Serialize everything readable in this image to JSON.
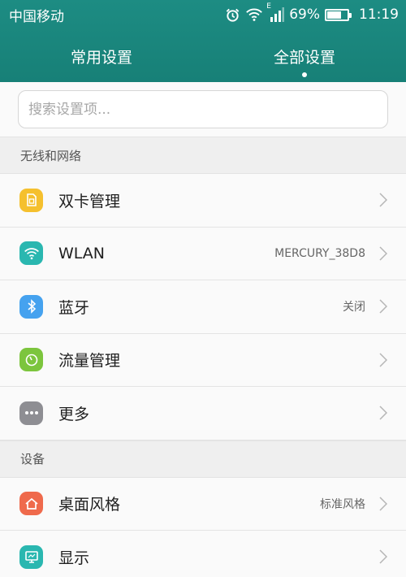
{
  "status_bar": {
    "carrier": "中国移动",
    "signal_label": "E",
    "battery_percent": "69%",
    "battery_level": 0.69,
    "time": "11:19",
    "icons": [
      "alarm-icon",
      "wifi-icon",
      "cellular-signal-icon",
      "battery-icon"
    ]
  },
  "tabs": [
    {
      "label": "常用设置",
      "active": false
    },
    {
      "label": "全部设置",
      "active": true
    }
  ],
  "search": {
    "placeholder": "搜索设置项..."
  },
  "sections": [
    {
      "title": "无线和网络",
      "items": [
        {
          "label": "双卡管理",
          "value": "",
          "icon": "sim-card-icon",
          "color": "#f5c02e"
        },
        {
          "label": "WLAN",
          "value": "MERCURY_38D8",
          "icon": "wifi-icon",
          "color": "#2ab7b0"
        },
        {
          "label": "蓝牙",
          "value": "关闭",
          "icon": "bluetooth-icon",
          "color": "#45a2ef"
        },
        {
          "label": "流量管理",
          "value": "",
          "icon": "data-usage-icon",
          "color": "#7cc53d"
        },
        {
          "label": "更多",
          "value": "",
          "icon": "more-icon",
          "color": "#8e8e93"
        }
      ]
    },
    {
      "title": "设备",
      "items": [
        {
          "label": "桌面风格",
          "value": "标准风格",
          "icon": "home-icon",
          "color": "#ef6a4c"
        },
        {
          "label": "显示",
          "value": "",
          "icon": "display-icon",
          "color": "#2ab7b0"
        }
      ]
    }
  ],
  "colors": {
    "header": "#178077",
    "chevron": "#b5b5b5"
  }
}
